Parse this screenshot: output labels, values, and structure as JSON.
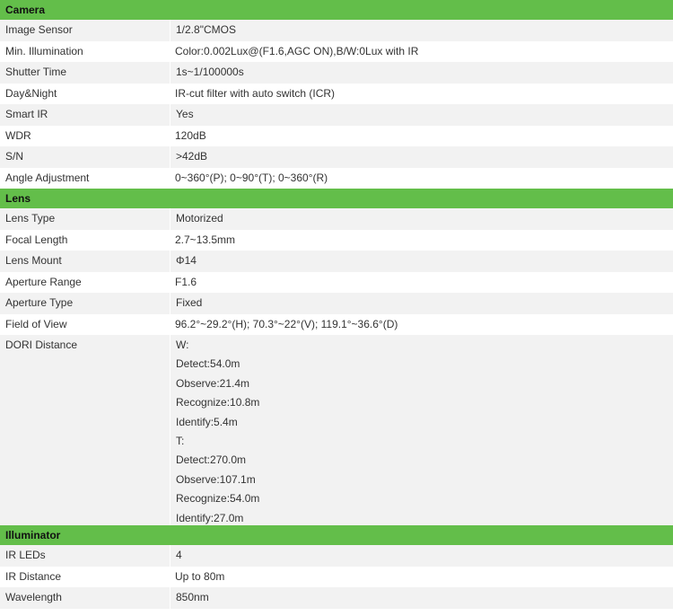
{
  "sections": [
    {
      "title": "Camera",
      "rows": [
        {
          "label": "Image Sensor",
          "value": "1/2.8\"CMOS"
        },
        {
          "label": "Min. Illumination",
          "value": "Color:0.002Lux@(F1.6,AGC ON),B/W:0Lux with IR"
        },
        {
          "label": "Shutter Time",
          "value": "1s~1/100000s"
        },
        {
          "label": "Day&Night",
          "value": "IR-cut filter with auto switch (ICR)"
        },
        {
          "label": "Smart IR",
          "value": "Yes"
        },
        {
          "label": "WDR",
          "value": "120dB"
        },
        {
          "label": "S/N",
          "value": ">42dB"
        },
        {
          "label": "Angle Adjustment",
          "value": "0~360°(P); 0~90°(T); 0~360°(R)"
        }
      ]
    },
    {
      "title": "Lens",
      "rows": [
        {
          "label": "Lens Type",
          "value": "Motorized"
        },
        {
          "label": "Focal Length",
          "value": "2.7~13.5mm"
        },
        {
          "label": "Lens Mount",
          "value": "Φ14"
        },
        {
          "label": "Aperture Range",
          "value": "F1.6"
        },
        {
          "label": "Aperture Type",
          "value": "Fixed"
        },
        {
          "label": "Field of View",
          "value": "96.2°~29.2°(H); 70.3°~22°(V); 119.1°~36.6°(D)"
        },
        {
          "label": "DORI Distance",
          "lines": [
            "W:",
            "Detect:54.0m",
            "Observe:21.4m",
            "Recognize:10.8m",
            "Identify:5.4m",
            "T:",
            "Detect:270.0m",
            "Observe:107.1m",
            "Recognize:54.0m",
            "Identify:27.0m"
          ]
        }
      ]
    },
    {
      "title": "Illuminator",
      "rows": [
        {
          "label": "IR LEDs",
          "value": "4"
        },
        {
          "label": "IR Distance",
          "value": "Up to 80m"
        },
        {
          "label": "Wavelength",
          "value": "850nm"
        }
      ]
    }
  ],
  "colors": {
    "section_header_bg": "#63be4a",
    "alt_row_bg": "#f2f2f2",
    "text": "#333333"
  }
}
